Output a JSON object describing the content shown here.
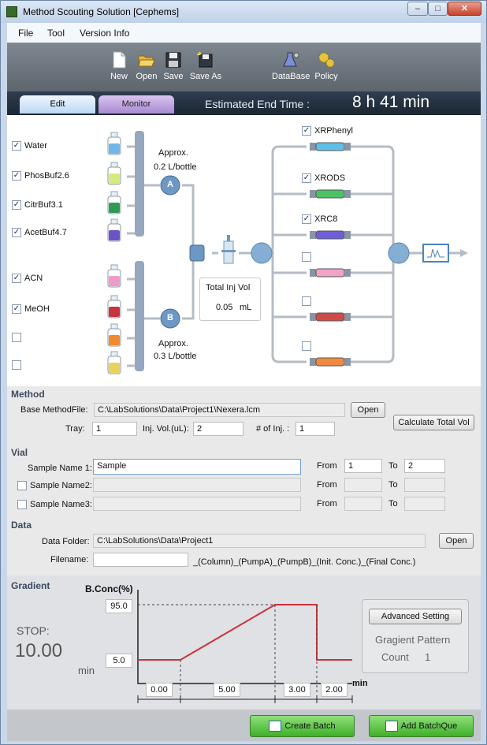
{
  "window": {
    "title": "Method Scouting Solution  [Cephems]",
    "min_glyph": "–",
    "max_glyph": "□",
    "close_glyph": "✕"
  },
  "menu": [
    "File",
    "Tool",
    "Version Info"
  ],
  "toolbar": {
    "new": "New",
    "open": "Open",
    "save": "Save",
    "save_as": "Save As",
    "database": "DataBase",
    "policy": "Policy"
  },
  "tabs": {
    "edit": "Edit",
    "monitor": "Monitor"
  },
  "estimate": {
    "label": "Estimated End Time :",
    "value": "8 h 41 min"
  },
  "pump_a": {
    "solvents": [
      {
        "name": "Water",
        "checked": true,
        "color": "#6fb7e8"
      },
      {
        "name": "PhosBuf2.6",
        "checked": true,
        "color": "#d6ec7a"
      },
      {
        "name": "CitrBuf3.1",
        "checked": true,
        "color": "#2f9a58"
      },
      {
        "name": "AcetBuf4.7",
        "checked": true,
        "color": "#6b53c8"
      }
    ],
    "approx_line1": "Approx.",
    "approx_line2": "0.2 L/bottle",
    "letter": "A"
  },
  "pump_b": {
    "solvents": [
      {
        "name": "ACN",
        "checked": true,
        "color": "#f09ac8"
      },
      {
        "name": "MeOH",
        "checked": true,
        "color": "#c8343e"
      },
      {
        "name": "",
        "checked": false,
        "color": "#f08a2c"
      },
      {
        "name": "",
        "checked": false,
        "color": "#ead15a"
      }
    ],
    "approx_line1": "Approx.",
    "approx_line2": "0.3 L/bottle",
    "letter": "B"
  },
  "injection": {
    "label": "Total Inj Vol",
    "value": "0.05",
    "unit": "mL"
  },
  "columns": [
    {
      "name": "XRPhenyl",
      "checked": true,
      "color": "#5fbfe6"
    },
    {
      "name": "XRODS",
      "checked": true,
      "color": "#4cc266"
    },
    {
      "name": "XRC8",
      "checked": true,
      "color": "#6e60d8"
    },
    {
      "name": "",
      "checked": false,
      "color": "#f1a3c6"
    },
    {
      "name": "",
      "checked": false,
      "color": "#d04a4a"
    },
    {
      "name": "",
      "checked": false,
      "color": "#f08a40"
    }
  ],
  "method": {
    "title": "Method",
    "base_label": "Base MethodFile:",
    "base_value": "C:\\LabSolutions\\Data\\Project1\\Nexera.lcm",
    "open": "Open",
    "tray_label": "Tray:",
    "tray": "1",
    "inj_label": "Inj. Vol.(uL):",
    "inj": "2",
    "num_label": "# of Inj. :",
    "num": "1",
    "calc": "Calculate Total Vol"
  },
  "vial": {
    "title": "Vial",
    "rows": [
      {
        "label": "Sample Name 1:",
        "value": "Sample",
        "from": "1",
        "to": "2",
        "checkbox": false
      },
      {
        "label": "Sample Name2:",
        "value": "",
        "from": "",
        "to": "",
        "checkbox": true
      },
      {
        "label": "Sample Name3:",
        "value": "",
        "from": "",
        "to": "",
        "checkbox": true
      }
    ],
    "from_label": "From",
    "to_label": "To"
  },
  "data": {
    "title": "Data",
    "folder_label": "Data Folder:",
    "folder": "C:\\LabSolutions\\Data\\Project1",
    "open": "Open",
    "file_label": "Filename:",
    "file": "",
    "suffix": "_(Column)_(PumpA)_(PumpB)_(Init. Conc.)_(Final Conc.)"
  },
  "gradient": {
    "title": "Gradient",
    "stop_label": "STOP:",
    "stop_value": "10.00",
    "min_label": "min",
    "yaxis": "B.Conc(%)",
    "xaxis": "min",
    "conc_high": "95.0",
    "conc_low": "5.0",
    "segments": [
      "0.00",
      "5.00",
      "3.00",
      "2.00"
    ],
    "advanced": "Advanced Setting",
    "pattern_label": "Gragient Pattern",
    "count_label": "Count",
    "count": "1"
  },
  "chart_data": {
    "type": "line",
    "ylabel": "B.Conc(%)",
    "xlabel": "min",
    "series": [
      {
        "x": [
          0,
          2,
          7,
          10,
          10,
          12
        ],
        "y": [
          5,
          5,
          95,
          95,
          5,
          5
        ]
      }
    ],
    "segments": [
      0,
      5,
      3,
      2
    ],
    "ylevels": [
      5,
      95
    ]
  },
  "actions": {
    "create": "Create Batch",
    "add": "Add BatchQue"
  },
  "colors": {
    "line": "#d9534f",
    "pipe": "#b6bcc4",
    "bar": "#95a8bf",
    "toolbar": "#6c747d"
  }
}
